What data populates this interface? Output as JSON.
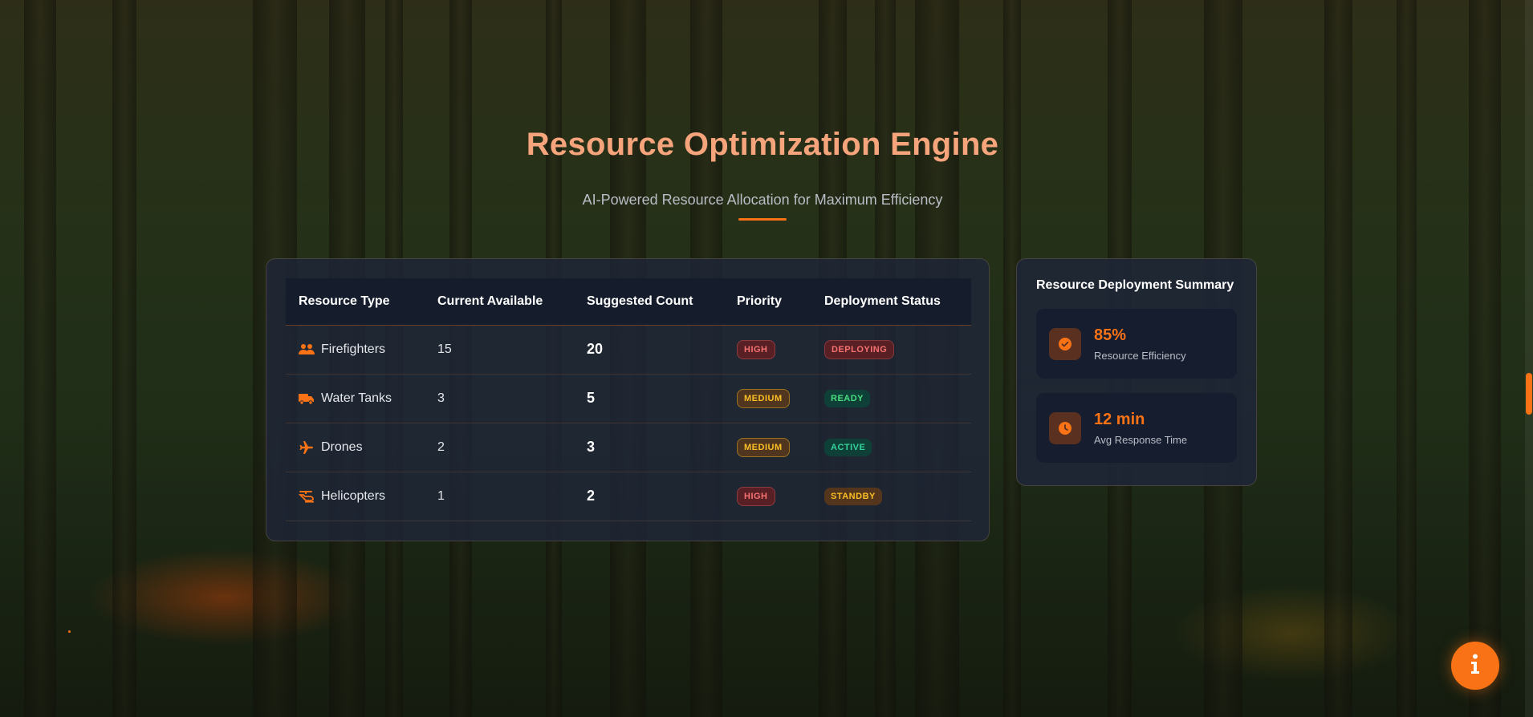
{
  "header": {
    "title": "Resource Optimization Engine",
    "subtitle": "AI-Powered Resource Allocation for Maximum Efficiency"
  },
  "table": {
    "columns": [
      "Resource Type",
      "Current Available",
      "Suggested Count",
      "Priority",
      "Deployment Status"
    ],
    "rows": [
      {
        "icon": "users-icon",
        "type": "Firefighters",
        "available": "15",
        "suggested": "20",
        "priority": "HIGH",
        "status": "DEPLOYING"
      },
      {
        "icon": "truck-icon",
        "type": "Water Tanks",
        "available": "3",
        "suggested": "5",
        "priority": "MEDIUM",
        "status": "READY"
      },
      {
        "icon": "plane-icon",
        "type": "Drones",
        "available": "2",
        "suggested": "3",
        "priority": "MEDIUM",
        "status": "ACTIVE"
      },
      {
        "icon": "helicopter-icon",
        "type": "Helicopters",
        "available": "1",
        "suggested": "2",
        "priority": "HIGH",
        "status": "STANDBY"
      }
    ]
  },
  "summary": {
    "title": "Resource Deployment Summary",
    "metrics": [
      {
        "icon": "check-circle-icon",
        "value": "85%",
        "label": "Resource Efficiency"
      },
      {
        "icon": "clock-icon",
        "value": "12 min",
        "label": "Avg Response Time"
      }
    ]
  },
  "fab": {
    "icon": "info-icon"
  },
  "colors": {
    "accent": "#f97316",
    "title": "#f5a47c",
    "card_bg": "#1e2638",
    "high": "#f87171",
    "medium": "#fbbf24",
    "ready": "#4ade80",
    "active": "#34d399"
  }
}
